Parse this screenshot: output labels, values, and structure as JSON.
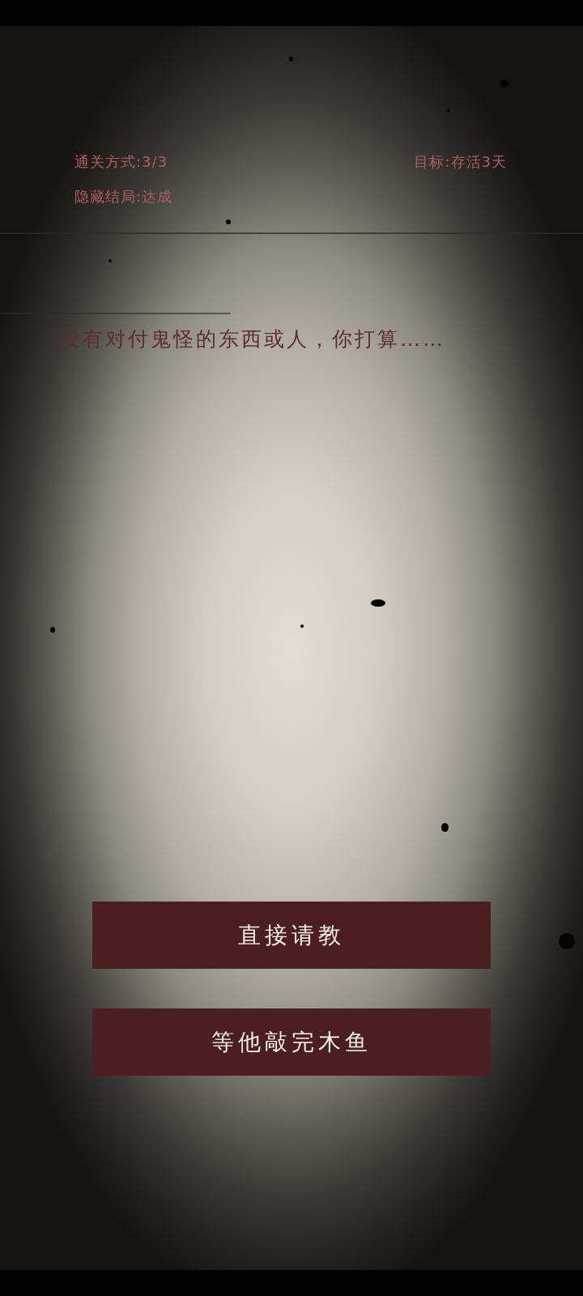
{
  "header": {
    "clear_methods": "通关方式:3/3",
    "goal": "目标:存活3天",
    "hidden_ending": "隐藏结局:达成"
  },
  "prompt": "没有对付鬼怪的东西或人，你打算……",
  "choices": [
    {
      "label": "直接请教"
    },
    {
      "label": "等他敲完木鱼"
    }
  ]
}
